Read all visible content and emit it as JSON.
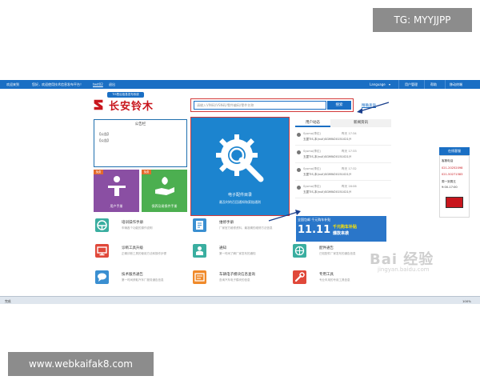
{
  "watermarks": {
    "top": "TG: MYYJJPP",
    "bottom": "www.webkaifak8.com"
  },
  "topbar": {
    "site_name": "欢迎来到",
    "welcome": "您好，欢迎使用技术信息发布平台！",
    "user": "test02",
    "logout": "退出",
    "language": "Language",
    "account": "用户管理",
    "help": "帮助",
    "mobile": "移动终端"
  },
  "brand": {
    "badge": "TIS售后信息发布系统",
    "name": "长安铃木"
  },
  "search": {
    "placeholder": "请输入VIN码/VSN码/零件编码/零件名称",
    "button": "搜索",
    "advanced": "精确查询"
  },
  "notice": {
    "title": "公告栏",
    "items": [
      "【公告】",
      "【公告】"
    ]
  },
  "hero": {
    "title": "电子配件目录",
    "subtitle": "最及时的召回通知和索赔通则"
  },
  "tiles": [
    {
      "label": "用户手册",
      "badge": "免费",
      "color": "#8a4fa3"
    },
    {
      "label": "保养及易损件手册",
      "badge": "免费",
      "color": "#4caf50"
    }
  ],
  "activity": {
    "tabs": [
      "用户动态",
      "新闻资讯"
    ],
    "items": [
      {
        "user": "Sysmo(李红)",
        "time": "昨天 17:34",
        "text": "五菱TIS,本(null)SGMW20151021/Y"
      },
      {
        "user": "Sysmo(李红)",
        "time": "昨天 17:33",
        "text": "五菱TIS,本(null)SGMW20151021/Y"
      },
      {
        "user": "Sysmo(李红)",
        "time": "昨天 17:32",
        "text": "五菱TIS,本(null)SGMW20151021/Y"
      },
      {
        "user": "Sysmo(李红)",
        "time": "昨天 16:06",
        "text": "五菱TIS,本(null)SGMW20151021/Y"
      }
    ]
  },
  "banner": {
    "top": "全国包邮 千元购车补贴",
    "main": "11.11",
    "side1": "千元购车补贴",
    "side2": "爆款来袭"
  },
  "functions": [
    {
      "title": "培训操作手册",
      "desc": "车辆各个功能的操作说明",
      "icon": "steering-wheel-icon",
      "color": "#3aaea0"
    },
    {
      "title": "维修手册",
      "desc": "厂家官方维修资料，最准确的维修方法信息",
      "icon": "manual-icon",
      "color": "#3a8fd1"
    },
    {
      "title": "诊断工具升级",
      "desc": "正确诊断工具的使用方法和操作步骤",
      "icon": "monitor-icon",
      "color": "#e0483a"
    },
    {
      "title": "通知",
      "desc": "第一时间了解厂家发布的通知",
      "icon": "person-notice-icon",
      "color": "#3aaea0"
    },
    {
      "title": "配件通告",
      "desc": "已知配件厂家发布的通告信息",
      "icon": "network-icon",
      "color": "#3aaea0"
    },
    {
      "title": "技术服务通告",
      "desc": "第一时间获取汽车厂服务通告信息",
      "icon": "chat-icon",
      "color": "#3a8fd1"
    },
    {
      "title": "车辆电子模块信息查询",
      "desc": "查询汽车电子模块的信息",
      "icon": "module-icon",
      "color": "#f08a2a"
    },
    {
      "title": "专用工具",
      "desc": "专业车用的专用工具信息",
      "icon": "wrench-icon",
      "color": "#e0483a"
    }
  ],
  "service": {
    "tab": "在线客服",
    "label": "客服电话",
    "phone1": "021-20252098",
    "phone2": "021-50271583",
    "hours_label": "周一到周五",
    "hours": "9:00-17:00"
  },
  "statusbar": {
    "left": "完成",
    "zoom": "100%"
  },
  "baidu": {
    "logo": "Bai 经验",
    "url": "jingyan.baidu.com"
  }
}
